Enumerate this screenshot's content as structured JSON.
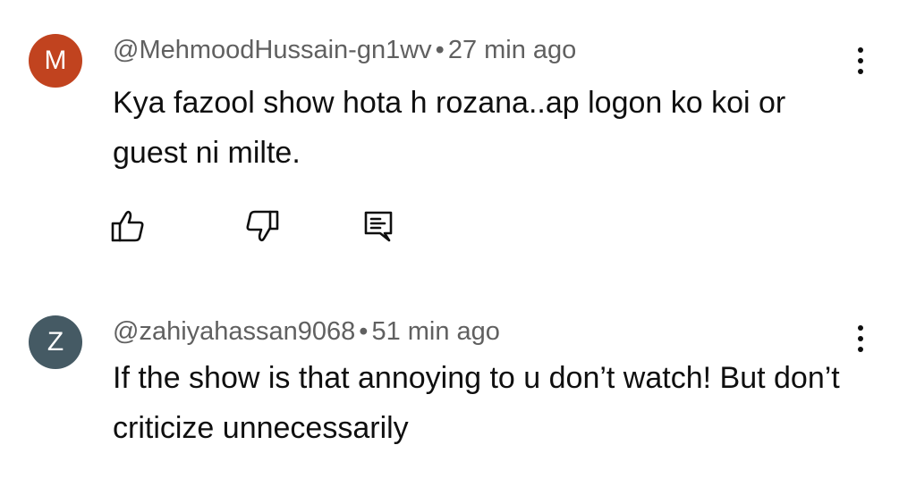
{
  "comments": [
    {
      "avatar_letter": "M",
      "avatar_color": "#c1431f",
      "author": "@MehmoodHussain-gn1wv",
      "separator": "•",
      "time": "27 min ago",
      "text": "Kya fazool show hota h rozana..ap logon ko koi or guest ni milte.",
      "actions": {
        "like_icon": "thumbs-up-icon",
        "dislike_icon": "thumbs-down-icon",
        "reply_icon": "reply-icon"
      },
      "menu_icon": "more-vert-icon"
    },
    {
      "avatar_letter": "Z",
      "avatar_color": "#455a64",
      "author": "@zahiyahassan9068",
      "separator": "•",
      "time": "51 min ago",
      "text": "If the show is that annoying to u don’t watch! But don’t criticize unnecessarily",
      "menu_icon": "more-vert-icon"
    }
  ]
}
